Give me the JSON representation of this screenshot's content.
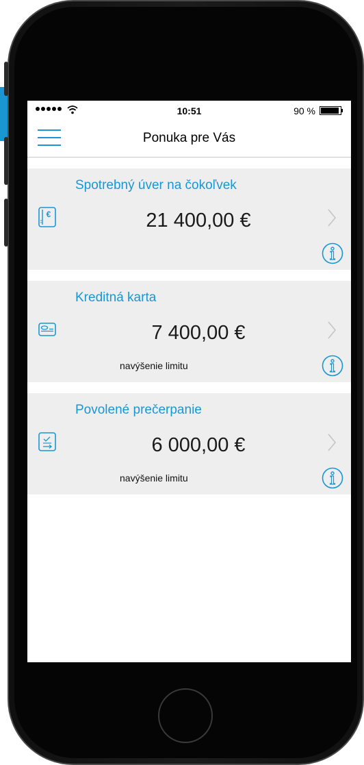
{
  "status": {
    "time": "10:51",
    "battery_pct": "90 %",
    "icons": [
      "signal-dots-icon",
      "wifi-icon",
      "battery-icon"
    ]
  },
  "header": {
    "title": "Ponuka pre Vás",
    "menu_icon": "hamburger-menu-icon"
  },
  "offers": [
    {
      "title": "Spotrebný úver na čokoľvek",
      "amount": "21 400,00 €",
      "subtitle": "",
      "icon": "euro-document-icon"
    },
    {
      "title": "Kreditná karta",
      "amount": "7 400,00 €",
      "subtitle": "navýšenie limitu",
      "icon": "credit-card-icon"
    },
    {
      "title": "Povolené prečerpanie",
      "amount": "6 000,00 €",
      "subtitle": "navýšenie limitu",
      "icon": "overdraft-icon"
    }
  ],
  "colors": {
    "accent": "#1a96d3",
    "card_background": "#eeeeee",
    "phone_frame": "#141414"
  }
}
